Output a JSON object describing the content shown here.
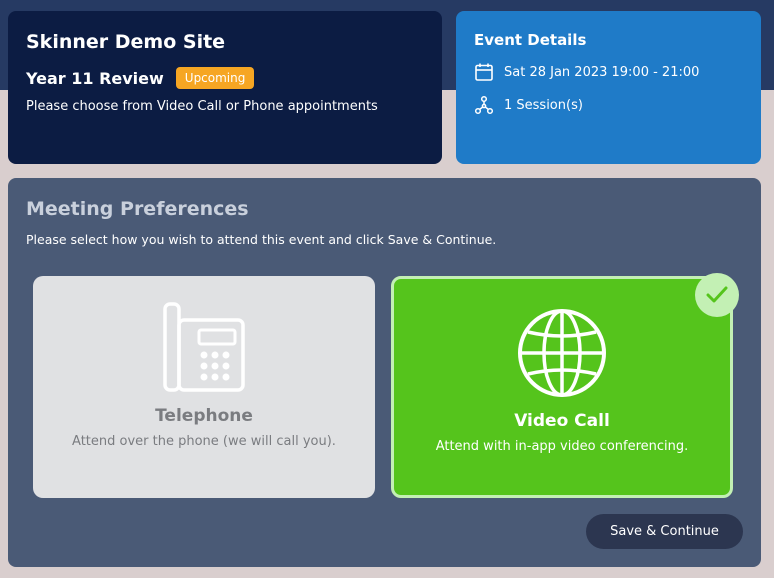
{
  "site": {
    "title": "Skinner Demo Site",
    "event_name": "Year 11 Review",
    "badge": "Upcoming",
    "description": "Please choose from Video Call or Phone appointments"
  },
  "event_details": {
    "title": "Event Details",
    "date": "Sat 28 Jan 2023 19:00 - 21:00",
    "sessions": "1 Session(s)",
    "date_icon": "calendar-icon",
    "sessions_icon": "sessions-network-icon"
  },
  "preferences": {
    "title": "Meeting Preferences",
    "description": "Please select how you wish to attend this event and click Save & Continue.",
    "options": [
      {
        "label": "Telephone",
        "description": "Attend over the phone (we will call you).",
        "icon": "telephone-icon",
        "selected": false
      },
      {
        "label": "Video Call",
        "description": "Attend with in-app video conferencing.",
        "icon": "globe-icon",
        "selected": true
      }
    ],
    "save_label": "Save & Continue"
  },
  "colors": {
    "site_card": "#0c1c43",
    "event_card": "#1f7bc8",
    "prefs_card": "#4a5a76",
    "badge": "#f6a623",
    "selected": "#55c41c"
  }
}
